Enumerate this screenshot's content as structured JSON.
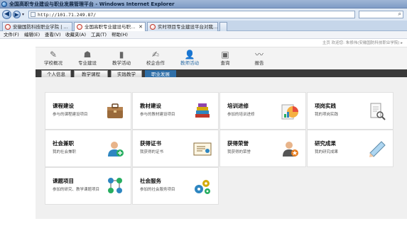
{
  "window": {
    "title": "全国高职专业建设与职业发展管理平台 - Windows Internet Explorer"
  },
  "address": {
    "url": "http://101.71.249.87/",
    "search_placeholder": "",
    "search_glyph": "⌕"
  },
  "tabs": [
    {
      "label": "安徽国防科技职业学院 | …"
    },
    {
      "label": "全国高职专业建设与职…"
    },
    {
      "label": "实时项目专业建设平台对我…"
    },
    {
      "label": ""
    }
  ],
  "menu": [
    "文件(F)",
    "编辑(E)",
    "查看(V)",
    "收藏夹(A)",
    "工具(T)",
    "帮助(H)"
  ],
  "user_line": "主页  欢迎您: 朱修伟(安徽国防科技职业学院) ▸",
  "main_nav": [
    {
      "label": "学校概况",
      "icon": "pencil-icon",
      "glyph": "✎"
    },
    {
      "label": "专业建设",
      "icon": "people-icon",
      "glyph": "☗"
    },
    {
      "label": "教学活动",
      "icon": "book-icon",
      "glyph": "▮"
    },
    {
      "label": "校企合作",
      "icon": "edit-doc-icon",
      "glyph": "✍"
    },
    {
      "label": "教师活动",
      "icon": "teacher-icon",
      "glyph": "👤",
      "active": true
    },
    {
      "label": "查询",
      "icon": "screen-icon",
      "glyph": "▣"
    },
    {
      "label": "报告",
      "icon": "pulse-icon",
      "glyph": "〰"
    }
  ],
  "sub_nav": [
    "个人信息",
    "教学课程",
    "实践教学",
    "职业发展"
  ],
  "sub_nav_active": "职业发展",
  "cards": [
    {
      "title": "课程建设",
      "desc": "参与的课程建设项目",
      "icon": "briefcase-icon"
    },
    {
      "title": "教材建设",
      "desc": "参与的教材建设项目",
      "icon": "books-icon"
    },
    {
      "title": "培训进修",
      "desc": "参加的培训进修",
      "icon": "chart-icon"
    },
    {
      "title": "项岗实践",
      "desc": "我的项岗实践",
      "icon": "document-search-icon"
    },
    {
      "title": "社会兼职",
      "desc": "我的社会兼职",
      "icon": "user-add-icon"
    },
    {
      "title": "获得证书",
      "desc": "我获得的证书",
      "icon": "certificate-icon"
    },
    {
      "title": "获得荣誉",
      "desc": "我获得的荣誉",
      "icon": "honor-user-icon"
    },
    {
      "title": "研究成果",
      "desc": "我的研究成果",
      "icon": "paper-icon"
    },
    {
      "title": "课题项目",
      "desc": "参加的研究、教学课题项目",
      "icon": "network-icon"
    },
    {
      "title": "社会服务",
      "desc": "参加的社会服务项目",
      "icon": "gears-icon"
    }
  ]
}
